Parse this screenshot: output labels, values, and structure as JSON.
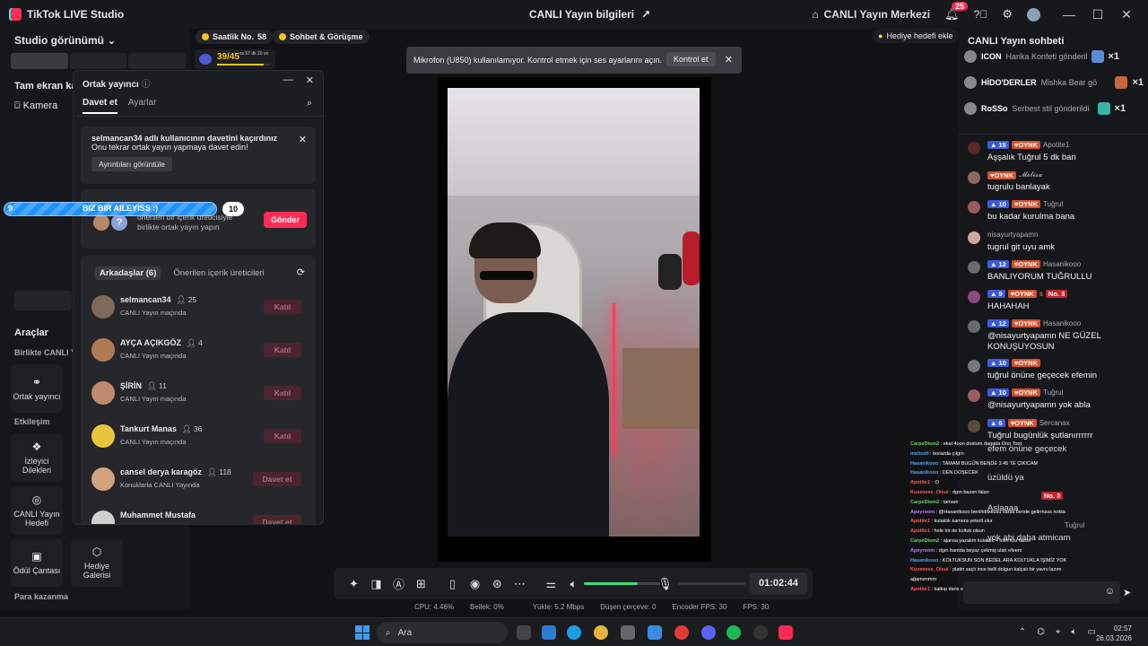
{
  "titlebar": {
    "app_name": "TikTok LIVE Studio",
    "center_title": "CANLI Yayın bilgileri",
    "live_center": "CANLI Yayın Merkezi",
    "notif_count": "25"
  },
  "left": {
    "studio_view": "Studio görünümü",
    "fullscreen": "Tam ekran kam",
    "camera": "Kamera",
    "tools": "Araçlar",
    "together_live": "Birlikte CANLI Yay",
    "cohost_tool": "Ortak yayıncı",
    "engagement": "Etkileşim",
    "viewer_requests": "İzleyici Dilekleri",
    "live_goal": "CANLI Yayın Hedefi",
    "reward_bag": "Ödül Çantası",
    "gift_gallery": "Hediye Galerisi",
    "earning": "Para kazanma"
  },
  "top_chips": {
    "hourly_label": "Saatlik No.",
    "hourly_value": "58",
    "chat_meet": "Sohbet & Görüşme",
    "hourly_progress": "39/45",
    "hourly_time": "ss 57 dk 20 sn",
    "hourly_fill": 0.87,
    "gift_goal": "Hediye hedefi ekle"
  },
  "notification": {
    "text": "Mikrofon (U850) kullanılamıyor. Kontrol etmek için ses ayarlarını açın.",
    "button": "Kontrol et"
  },
  "dialog": {
    "title": "Ortak yayıncı",
    "tab_invite": "Davet et",
    "tab_settings": "Ayarlar",
    "missed_title": "selmancan34 adlı kullanıcının davetini kaçırdınız",
    "missed_body": "Onu tekrar ortak yayın yapmaya davet edin!",
    "missed_details": "Ayrıntıları görüntüle",
    "suggest_text": "önerilen bir içerik üreticisiyle birlikte ortak yayın yapın",
    "suggest_send": "Gönder",
    "friends_tab": "Arkadaşlar (6)",
    "suggested_tab": "Önerilen içerik üreticileri",
    "friends": [
      {
        "name": "selmancan34",
        "count": "25",
        "status": "CANLI Yayın maçında",
        "action": "Katıl",
        "color": "#7d6a5a"
      },
      {
        "name": "AYÇA AÇIKGÖZ",
        "count": "4",
        "status": "CANLI Yayın maçında",
        "action": "Katıl",
        "color": "#b07a55"
      },
      {
        "name": "ŞİRİN",
        "count": "11",
        "status": "CANLI Yayın maçında",
        "action": "Katıl",
        "color": "#c08a6e"
      },
      {
        "name": "Tankurt Manas",
        "count": "36",
        "status": "CANLI Yayın maçında",
        "action": "Katıl",
        "color": "#e9c43a"
      },
      {
        "name": "cansel derya karagöz",
        "count": "118",
        "status": "Konuklarla CANLI Yayında",
        "action": "Davet et",
        "color": "#d2a37c"
      },
      {
        "name": "Muhammet Mustafa",
        "count": "",
        "status": "",
        "action": "Davet et",
        "color": "#cfcfcf"
      }
    ]
  },
  "progress": {
    "left": "9",
    "text": "BIZ BIR AILEYISS :)",
    "right": "10"
  },
  "controls": {
    "timer": "01:02:44",
    "volume": 0.7
  },
  "stats": {
    "cpu": "CPU: 4.46%",
    "mem": "Bellek: 0%",
    "upload": "Yükle: 5.2 Mbps",
    "drop": "Düşen çerçeve: 0",
    "encfps": "Encoder FPS: 30",
    "fps": "FPS: 30"
  },
  "chat": {
    "title": "CANLI Yayın sohbeti",
    "gifts": [
      {
        "user": "ICON",
        "text": "Harika Konfeti gönderildi",
        "qty": "×1",
        "color": "#5a8bd6"
      },
      {
        "user": "HİDO'DERLER",
        "text": "Mishka Bear gö",
        "qty": "×1",
        "color": "#c7663b"
      },
      {
        "user": "RoSSo",
        "text": "Serbest stil gönderildi",
        "qty": "×1",
        "color": "#3bb3a4"
      }
    ],
    "messages": [
      {
        "lvl": "15",
        "oynk": "OYNK",
        "user": "Apotite1",
        "text": "Aşşalık Tuğrul 5 dk ban",
        "color": "#5a2a2a"
      },
      {
        "lvl": "",
        "oynk": "OYNK",
        "user": "𝓜𝓮𝓵𝓲𝓼𝓪",
        "text": "tugrulu banlayak",
        "color": "#8a6a58"
      },
      {
        "lvl": "10",
        "oynk": "OYNK",
        "user": "Tuğrul",
        "text": "bu kadar kurulma bana",
        "color": "#9c5b5b"
      },
      {
        "lvl": "",
        "oynk": "",
        "user": "nisayurtyapamn",
        "text": "tugrul git uyu amk",
        "color": "#cfa99a"
      },
      {
        "lvl": "12",
        "oynk": "OYNK",
        "user": "Hasanikooo",
        "text": "BANLIYORUM TUĞRULLU",
        "color": "#6a6a6a"
      },
      {
        "lvl": "9",
        "oynk": "OYNK",
        "user": "s",
        "text": "HAHAHAH",
        "rank": "No. 3",
        "color": "#8a4a7a"
      },
      {
        "lvl": "12",
        "oynk": "OYNK",
        "user": "Hasanikooo",
        "text": "@nisayurtyapamn NE GÜZEL KONUŞUYOSUN",
        "color": "#6a6a6a"
      },
      {
        "lvl": "10",
        "oynk": "OYNK",
        "user": "",
        "text": "tuğrul önüne geçecek efemin",
        "color": "#777"
      },
      {
        "lvl": "10",
        "oynk": "OYNK",
        "user": "Tuğrul",
        "text": "@nisayurtyapamn yok abla",
        "color": "#9c5b5b"
      },
      {
        "lvl": "6",
        "oynk": "OYNK",
        "user": "Sercanax",
        "text": "Tuğrul bugünlük şutlanırrrrrr",
        "color": "#5a4a3a"
      }
    ],
    "lower_lines": {
      "l1": "efem önüne geçecek",
      "l2": "üzüldü ya",
      "l3_rank": "No. 3",
      "l4": "Aslaaaa",
      "l5_user": "Tuğrul",
      "l6": "yok abi daha atmicam"
    }
  },
  "overlay": [
    {
      "user": "CarpeDiem2",
      "text": ": ekat 4oon dostum dagada Ooo Toot",
      "cls": "u"
    },
    {
      "user": "melisoll",
      "text": ": borazda çılgın",
      "cls": "u2"
    },
    {
      "user": "Hasanikooo",
      "text": ": TAMAM BUGÜN BENDE 3.45 TE ÇIKICAM",
      "cls": "u2"
    },
    {
      "user": "Hasanikooo",
      "text": ": DEN DOŞECEK",
      "cls": "u2"
    },
    {
      "user": "Apotite1",
      "text": ": :D",
      "cls": "u3"
    },
    {
      "user": "Kuzeneee_Oisui",
      "text": ": dgın bazen falan",
      "cls": "u3"
    },
    {
      "user": "CarpeDiem2",
      "text": ": tamam",
      "cls": "u"
    },
    {
      "user": "Apeyroom",
      "text": ": @Hasanikooo benihibiskusu varsa bende gelirmsss nokta",
      "cls": "u4"
    },
    {
      "user": "Apotite1",
      "text": ": kulaklık kamera yeterli olur",
      "cls": "u3"
    },
    {
      "user": "Apotite1",
      "text": ": hele bir de koltuk olsun",
      "cls": "u3"
    },
    {
      "user": "CarpeDiem2",
      "text": ": ajansa yazalım kulaklık + lotin koz lazım",
      "cls": "u"
    },
    {
      "user": "Apeyroom",
      "text": ": dgın bantda beyaz çekmiş ulan efeem",
      "cls": "u4"
    },
    {
      "user": "Hasanikooo",
      "text": ": KOLTUKSUN SON BEDEL ARA KOLTUKLA İŞİMİZ YOK",
      "cls": "u2"
    },
    {
      "user": "Kuzeneee_Oisui",
      "text": ": platin saçlı ince belli dolgun kalçalı bir yavru lazım",
      "cls": "u3"
    },
    {
      "user": "",
      "text": "ağamımmm",
      "cls": "u3"
    },
    {
      "user": "Apotite1",
      "text": ": kalkıp dans etmeslne engel olabilir doğru diyorsun hasanım :D",
      "cls": "u3"
    }
  ],
  "taskbar": {
    "search": "Ara",
    "time": "02:57",
    "date": "26.03.2026"
  }
}
